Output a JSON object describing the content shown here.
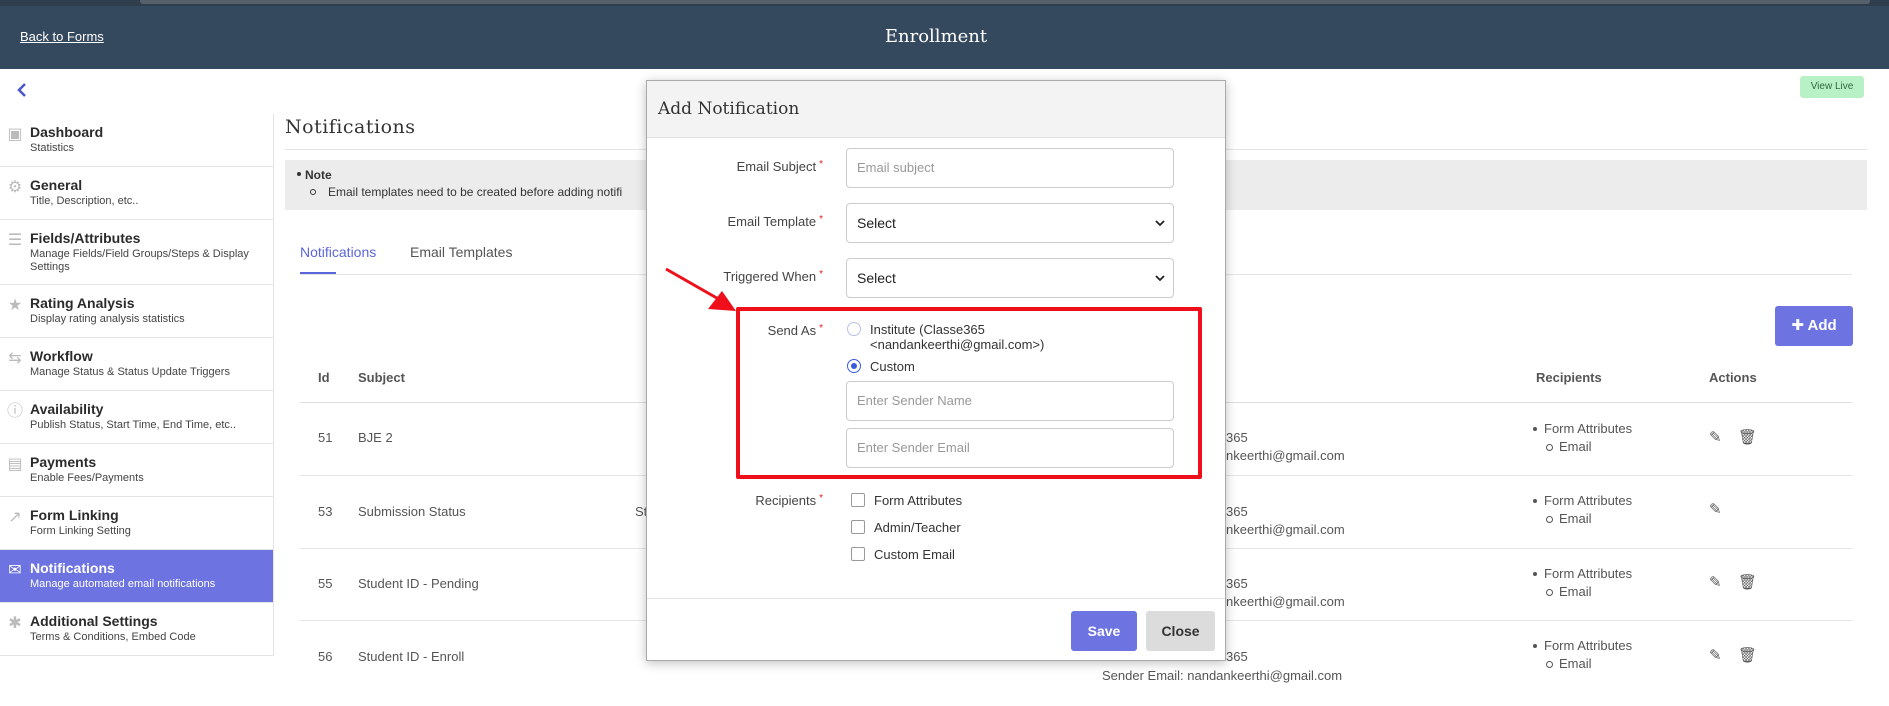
{
  "header": {
    "back_label": "Back to Forms",
    "title": "Enrollment",
    "view_live": "View Live"
  },
  "sidebar": {
    "items": [
      {
        "title": "Dashboard",
        "subtitle": "Statistics",
        "icon": "monitor-icon"
      },
      {
        "title": "General",
        "subtitle": "Title, Description, etc..",
        "icon": "gear-icon"
      },
      {
        "title": "Fields/Attributes",
        "subtitle": "Manage Fields/Field Groups/Steps & Display Settings",
        "icon": "list-icon"
      },
      {
        "title": "Rating Analysis",
        "subtitle": "Display rating analysis statistics",
        "icon": "star-icon"
      },
      {
        "title": "Workflow",
        "subtitle": "Manage Status & Status Update Triggers",
        "icon": "retweet-icon"
      },
      {
        "title": "Availability",
        "subtitle": "Publish Status, Start Time, End Time, etc..",
        "icon": "info-icon"
      },
      {
        "title": "Payments",
        "subtitle": "Enable Fees/Payments",
        "icon": "money-icon"
      },
      {
        "title": "Form Linking",
        "subtitle": "Form Linking Setting",
        "icon": "external-link-icon"
      },
      {
        "title": "Notifications",
        "subtitle": "Manage automated email notifications",
        "icon": "envelope-icon"
      },
      {
        "title": "Additional Settings",
        "subtitle": "Terms & Conditions, Embed Code",
        "icon": "asterisk-icon"
      }
    ]
  },
  "main": {
    "title": "Notifications",
    "note_title": "Note",
    "note_text": "Email templates need to be created before adding notifi",
    "tabs": [
      "Notifications",
      "Email Templates"
    ],
    "add_label": "Add",
    "table": {
      "headers": {
        "id": "Id",
        "subject": "Subject",
        "recipients": "Recipients",
        "actions": "Actions"
      },
      "rows": [
        {
          "id": "51",
          "subject": "BJE 2",
          "mid": "",
          "sender_name_tail": "365",
          "sender_email_tail": "nkeerthi@gmail.com",
          "recipients": "Form Attributes",
          "recipient_sub": "Email",
          "has_delete": true
        },
        {
          "id": "53",
          "subject": "Submission Status",
          "mid": "St",
          "sender_name_tail": "365",
          "sender_email_tail": "nkeerthi@gmail.com",
          "recipients": "Form Attributes",
          "recipient_sub": "Email",
          "has_delete": false
        },
        {
          "id": "55",
          "subject": "Student ID - Pending",
          "mid": "",
          "sender_name_tail": "365",
          "sender_email_tail": "nkeerthi@gmail.com",
          "recipients": "Form Attributes",
          "recipient_sub": "Email",
          "has_delete": true
        },
        {
          "id": "56",
          "subject": "Student ID - Enroll",
          "mid": "",
          "sender_name_tail": "365",
          "sender_email_tail": "Sender Email: nandankeerthi@gmail.com",
          "recipients": "Form Attributes",
          "recipient_sub": "Email",
          "has_delete": true
        }
      ]
    }
  },
  "modal": {
    "title": "Add Notification",
    "email_subject_label": "Email Subject",
    "email_subject_placeholder": "Email subject",
    "email_template_label": "Email Template",
    "email_template_value": "Select",
    "triggered_when_label": "Triggered When",
    "triggered_when_value": "Select",
    "send_as_label": "Send As",
    "send_as_option_1_line1": "Institute (Classe365",
    "send_as_option_1_line2": "<nandankeerthi@gmail.com>)",
    "send_as_option_2": "Custom",
    "sender_name_placeholder": "Enter Sender Name",
    "sender_email_placeholder": "Enter Sender Email",
    "recipients_label": "Recipients",
    "recipient_options": [
      "Form Attributes",
      "Admin/Teacher",
      "Custom Email"
    ],
    "save_label": "Save",
    "close_label": "Close"
  },
  "colors": {
    "header_bg": "#34495e",
    "accent": "#6d73e0",
    "highlight": "#ee0f1a"
  }
}
